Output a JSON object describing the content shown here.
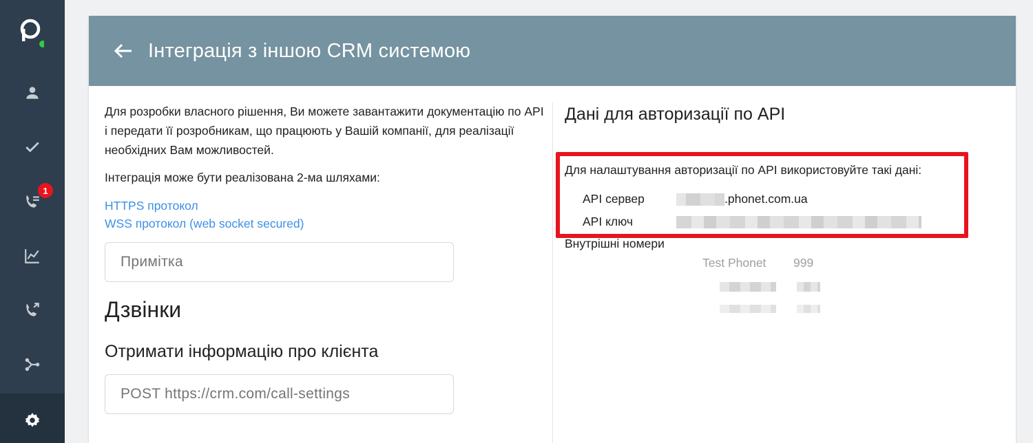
{
  "sidebar": {
    "logo_icon": "phonet-logo-icon",
    "items": [
      {
        "name": "contacts",
        "icon": "user-icon"
      },
      {
        "name": "tasks",
        "icon": "check-icon"
      },
      {
        "name": "call-queue",
        "icon": "phone-list-icon",
        "badge": "1"
      },
      {
        "name": "analytics",
        "icon": "chart-icon"
      },
      {
        "name": "calls",
        "icon": "phone-forward-icon"
      },
      {
        "name": "integrations",
        "icon": "share-icon"
      },
      {
        "name": "settings",
        "icon": "gear-icon",
        "active": true
      }
    ]
  },
  "header": {
    "title": "Інтеграція з іншою CRM системою",
    "color": "#7593a0"
  },
  "left": {
    "description": "Для розробки власного рішення, Ви можете завантажити документацію по API і передати її розробникам, що працюють у Вашій компанії, для реалізації необхідних Вам можливостей.",
    "ways_text": "Інтеграція може бути реалізована 2-ма шляхами:",
    "link_https": "HTTPS протокол",
    "link_wss": "WSS протокол (web socket secured)",
    "note_placeholder": "Примітка",
    "calls_heading": "Дзвінки",
    "client_info_heading": "Отримати інформацію про клієнта",
    "client_info_url": "POST https://crm.com/call-settings"
  },
  "right": {
    "api_title": "Дані для авторизації по API",
    "api_intro": "Для налаштування авторизації по API використовуйте такі дані:",
    "server_label": "API сервер",
    "server_value": ".phonet.com.ua",
    "key_label": "API ключ",
    "ext_title": "Внутрішні номери",
    "ext_name": "Test Phonet",
    "ext_num": "999",
    "highlight_color": "#e8141c"
  }
}
